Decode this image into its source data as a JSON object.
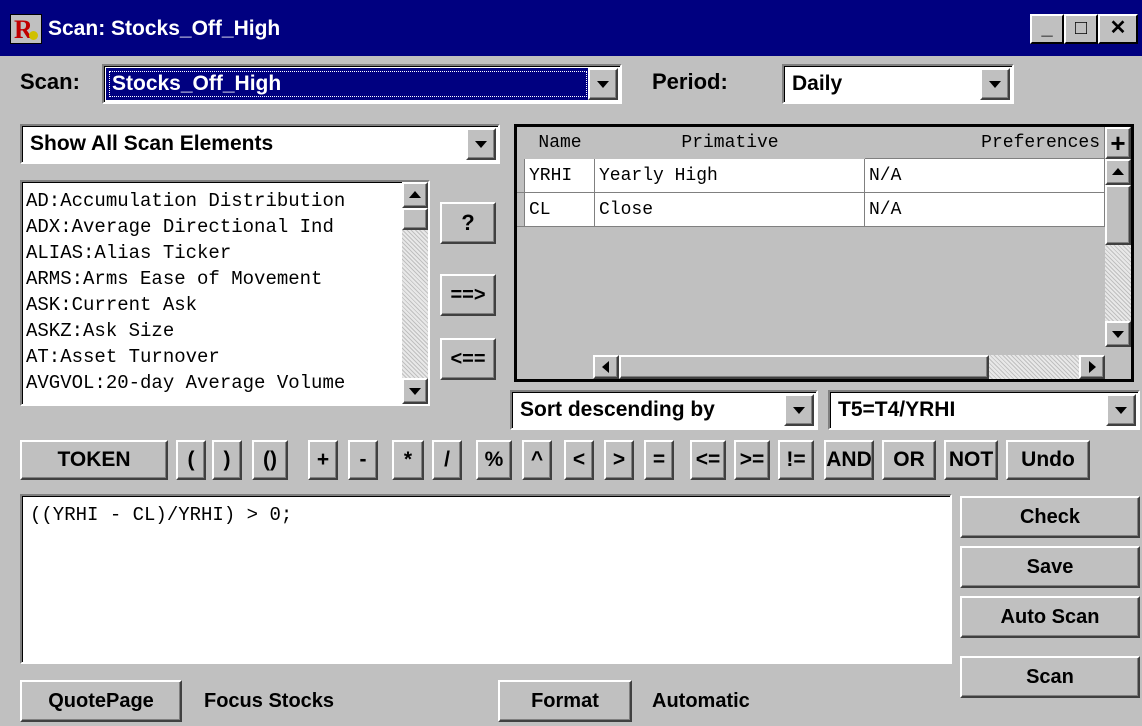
{
  "window": {
    "title": "Scan:  Stocks_Off_High"
  },
  "scan": {
    "label": "Scan:",
    "value": "Stocks_Off_High"
  },
  "period": {
    "label": "Period:",
    "value": "Daily"
  },
  "filter": {
    "value": "Show All Scan Elements"
  },
  "elements_list": [
    "AD:Accumulation Distribution",
    "ADX:Average Directional Ind",
    "ALIAS:Alias Ticker",
    "ARMS:Arms Ease of Movement",
    "ASK:Current Ask",
    "ASKZ:Ask Size",
    "AT:Asset Turnover",
    "AVGVOL:20-day Average Volume"
  ],
  "side_buttons": {
    "help": "?",
    "add": "==>",
    "remove": "<=="
  },
  "grid": {
    "headers": [
      "Name",
      "Primative",
      "Preferences"
    ],
    "plus": "+",
    "rows": [
      [
        "YRHI",
        "Yearly High",
        "N/A"
      ],
      [
        "CL",
        "Close",
        "N/A"
      ]
    ]
  },
  "sort": {
    "value": "Sort descending by"
  },
  "sort_field": {
    "value": "T5=T4/YRHI"
  },
  "token_button": "TOKEN",
  "operators": [
    "(",
    ")",
    "()",
    "+",
    "-",
    "*",
    "/",
    "%",
    "^",
    "<",
    ">",
    "=",
    "<=",
    ">=",
    "!=",
    "AND",
    "OR",
    "NOT",
    "Undo"
  ],
  "expression": "((YRHI - CL)/YRHI) > 0;",
  "actions": {
    "check": "Check",
    "save": "Save",
    "auto_scan": "Auto Scan",
    "scan": "Scan"
  },
  "footer": {
    "quotepage": "QuotePage",
    "focus_stocks": "Focus Stocks",
    "format": "Format",
    "automatic": "Automatic"
  }
}
